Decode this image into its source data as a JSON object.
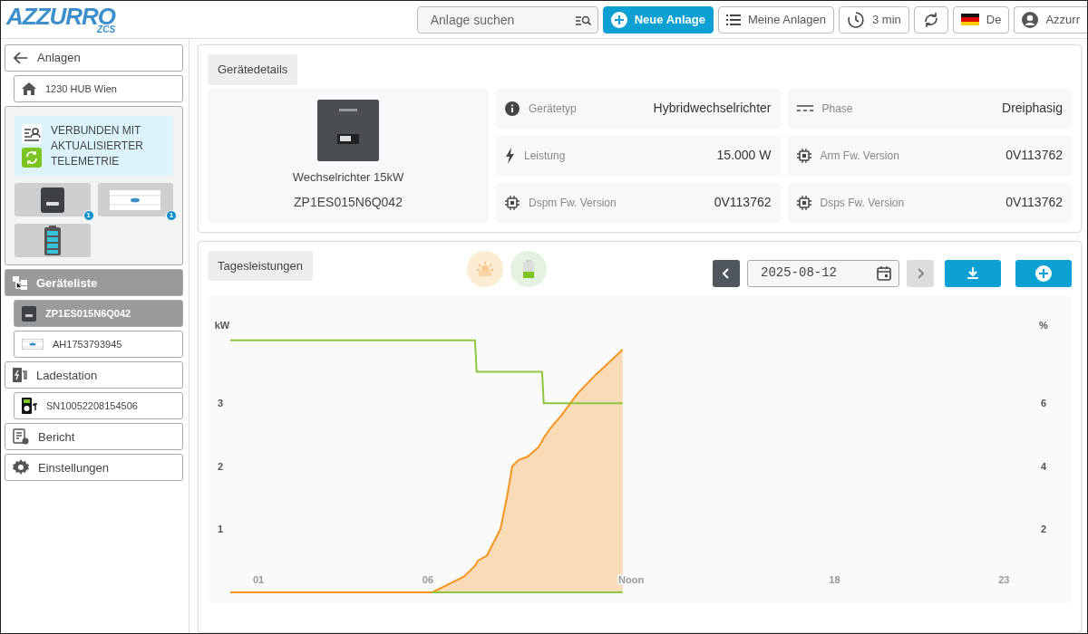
{
  "logo": {
    "text": "AZZURRO",
    "sub": "ZCS"
  },
  "topbar": {
    "search": {
      "placeholder": "Anlage suchen"
    },
    "buttons": [
      {
        "kind": "new",
        "label": "Neue Anlage"
      },
      {
        "kind": "list",
        "label": "Meine Anlagen"
      },
      {
        "kind": "interval",
        "label": "3 min"
      },
      {
        "kind": "refresh"
      },
      {
        "kind": "language",
        "label": "De"
      },
      {
        "kind": "account",
        "label": "Azzurr"
      }
    ]
  },
  "sidebar": {
    "back": "Anlagen",
    "plant": "1230 HUB Wien",
    "status": "VERBUNDEN MIT AKTUALISIERTER TELEMETRIE",
    "tiles": [
      {
        "kind": "inverter",
        "badge": "1"
      },
      {
        "kind": "meter",
        "badge": "1"
      },
      {
        "kind": "battery"
      }
    ],
    "items": [
      {
        "kind": "section",
        "label": "Geräteliste",
        "selected": true
      },
      {
        "kind": "device",
        "label": "ZP1ES015N6Q042",
        "selected": true
      },
      {
        "kind": "device",
        "label": "AH1753793945",
        "selected": false
      },
      {
        "kind": "section",
        "label": "Ladestation",
        "selected": false
      },
      {
        "kind": "device",
        "label": "SN10052208154506",
        "selected": false
      },
      {
        "kind": "section",
        "label": "Bericht",
        "selected": false
      },
      {
        "kind": "section",
        "label": "Einstellungen",
        "selected": false
      }
    ]
  },
  "details": {
    "title": "Gerätedetails",
    "device_name": "Wechselrichter 15kW",
    "serial": "ZP1ES015N6Q042",
    "fields": [
      {
        "label": "Gerätetyp",
        "value": "Hybridwechselrichter"
      },
      {
        "label": "Phase",
        "value": "Dreiphasig"
      },
      {
        "label": "Leistung",
        "value": "15.000 W"
      },
      {
        "label": "Arm Fw. Version",
        "value": "0V113762"
      },
      {
        "label": "Dspm Fw. Version",
        "value": "0V113762"
      },
      {
        "label": "Dsps Fw. Version",
        "value": "0V113762"
      }
    ]
  },
  "daily": {
    "title": "Tagesleistungen",
    "toggles": [
      {
        "kind": "sun",
        "color": "#fdecd4"
      },
      {
        "kind": "battery",
        "color": "#e4f3df"
      }
    ],
    "date": "2025-08-12",
    "prev": {
      "disabled": false
    },
    "next": {
      "disabled": true
    },
    "chart_data": {
      "type": "area",
      "ylabel": "kW",
      "xlim": [
        -0.5,
        25
      ],
      "ylim": [
        -0.16,
        4.7
      ],
      "xticks": [
        {
          "value": 1,
          "label": "01"
        },
        {
          "value": 6,
          "label": "06"
        },
        {
          "value": 12,
          "label": "Noon"
        },
        {
          "value": 18,
          "label": "18"
        },
        {
          "value": 23,
          "label": "23"
        }
      ],
      "yticks": [
        1,
        2,
        3
      ],
      "x": [
        0.17,
        6.13,
        6.51,
        7.07,
        7.39,
        7.44,
        7.47,
        7.74,
        7.95,
        8.14,
        8.33,
        8.49,
        8.68,
        8.94,
        9.26,
        9.37,
        9.42,
        9.61,
        9.93,
        10.41,
        10.95,
        11.35,
        11.75
      ],
      "series": [
        {
          "color": "#f7941d",
          "values": [
            0,
            0,
            0.1,
            0.25,
            0.42,
            0.46,
            0.5,
            0.58,
            0.8,
            1,
            1.5,
            2,
            2.1,
            2.15,
            2.3,
            2.4,
            2.45,
            2.6,
            2.8,
            3.15,
            3.45,
            3.65,
            3.85
          ]
        },
        {
          "color": "#8cc63f",
          "type": "line",
          "axis": "y2",
          "values": [
            8,
            8,
            8,
            8,
            8,
            7,
            7,
            7,
            7,
            7,
            7,
            7,
            7,
            7,
            7,
            7,
            6,
            6,
            6,
            6,
            6,
            6,
            6
          ]
        },
        {
          "color": "#8cc63f",
          "type": "line",
          "values": [
            null,
            0,
            0,
            0,
            0,
            0,
            0,
            0,
            0,
            0,
            0,
            0,
            0,
            0,
            0,
            0,
            0,
            0,
            0,
            0,
            0,
            0,
            0
          ]
        }
      ],
      "y2label": "%",
      "y2lim": [
        -0.32,
        9.4
      ],
      "y2ticks": [
        2,
        4,
        6
      ]
    }
  }
}
